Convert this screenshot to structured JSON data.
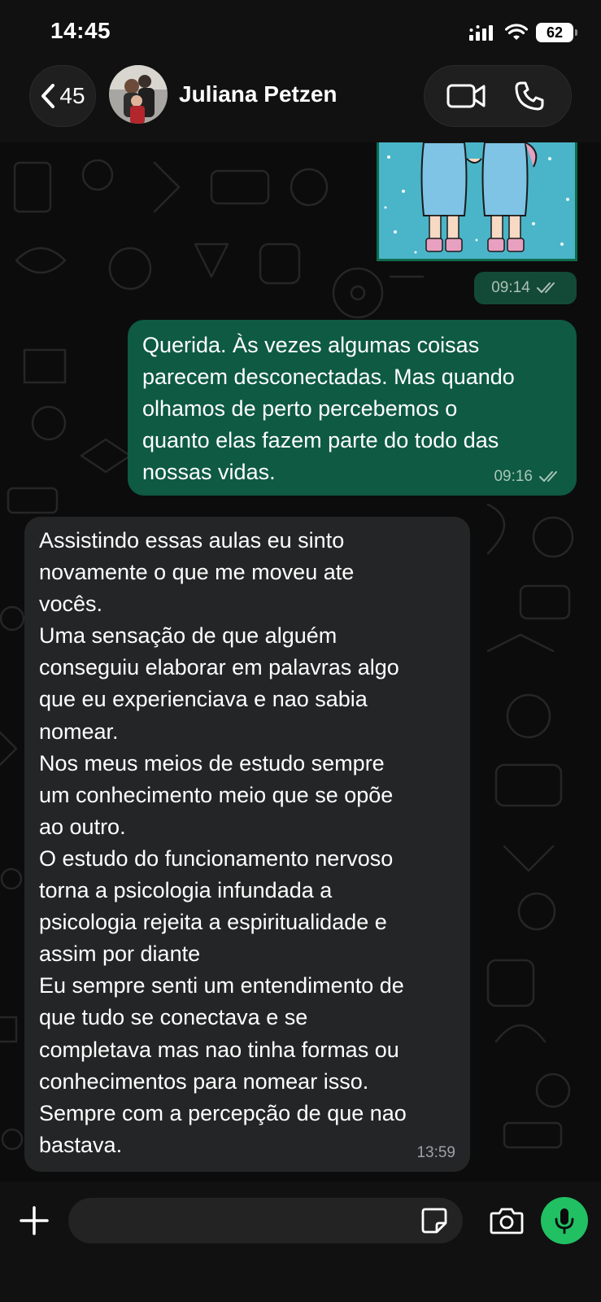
{
  "status_bar": {
    "time": "14:45",
    "battery": "62"
  },
  "header": {
    "back_count": "45",
    "contact_name": "Juliana Petzen",
    "icons": [
      "chevron-left-icon",
      "video-call-icon",
      "phone-icon"
    ]
  },
  "messages": {
    "image_message": {
      "time": "09:14",
      "status": "read"
    },
    "outgoing": {
      "text": "Querida. Às vezes algumas coisas\nparecem desconectadas. Mas quando\nolhamos de perto percebemos o\nquanto elas fazem parte do todo das\nnossas vidas.",
      "time": "09:16",
      "status": "read"
    },
    "incoming": {
      "text": "Assistindo essas aulas eu sinto\nnovamente o que me moveu ate\nvocês.\nUma sensação de que alguém\nconseguiu elaborar em palavras algo\nque eu experienciava e nao sabia\nnomear.\nNos meus meios de estudo sempre\num conhecimento meio que se opõe\nao outro.\nO estudo do funcionamento nervoso\ntorna a psicologia infundada a\npsicologia rejeita a espiritualidade e\nassim por diante\nEu sempre senti um entendimento de\nque tudo se conectava e se\ncompletava mas nao tinha formas ou\nconhecimentos para nomear isso.\nSempre com a percepção de que nao\nbastava.",
      "time": "13:59"
    }
  },
  "composer": {
    "placeholder": "",
    "icons": [
      "plus-icon",
      "sticker-icon",
      "camera-icon",
      "mic-icon"
    ]
  },
  "colors": {
    "outgoing_bubble": "#0e5a42",
    "incoming_bubble": "#242526",
    "accent": "#21c063"
  }
}
